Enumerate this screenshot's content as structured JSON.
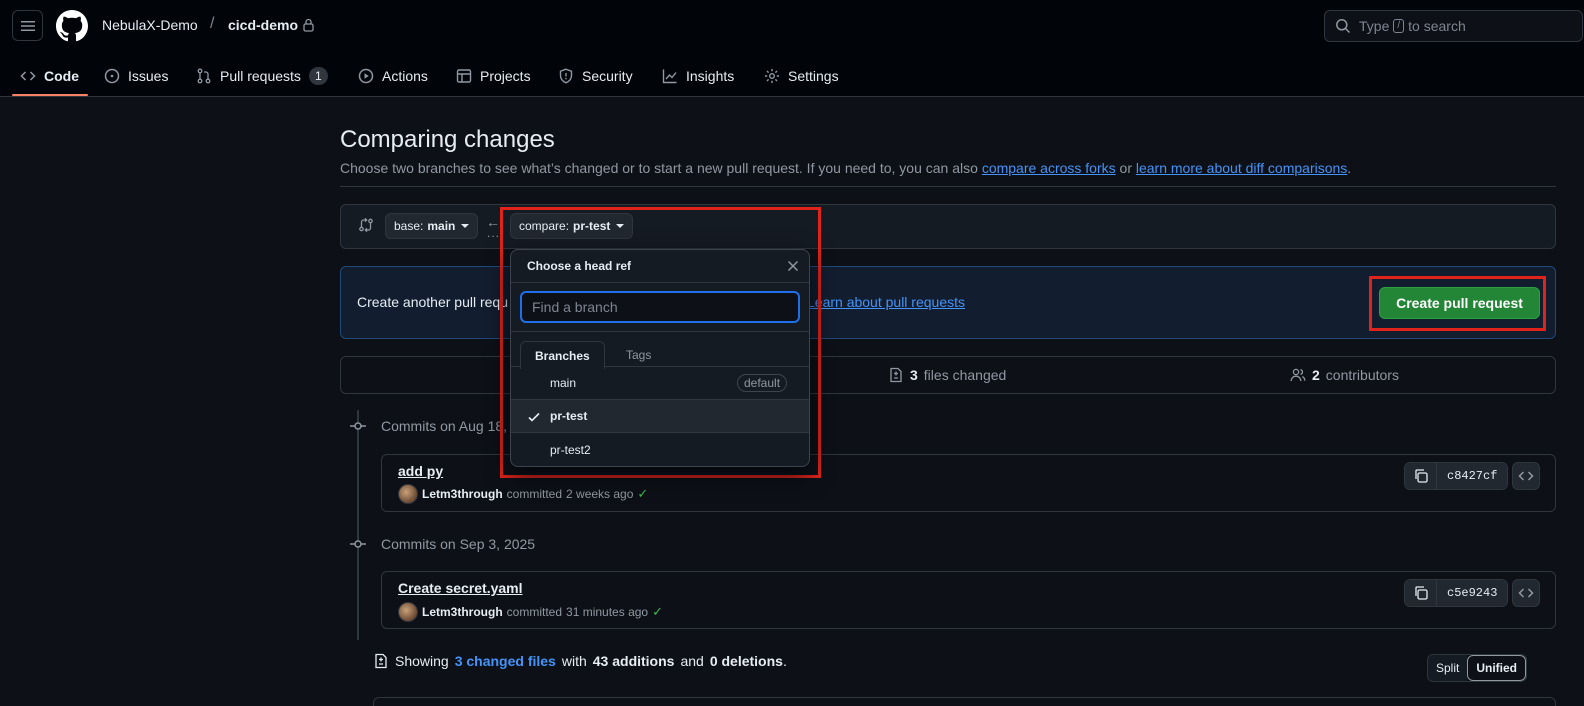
{
  "header": {
    "owner": "NebulaX-Demo",
    "separator": "/",
    "repo": "cicd-demo",
    "search_prefix": "Type",
    "search_key": "/",
    "search_suffix": "to search"
  },
  "nav": {
    "code": "Code",
    "issues": "Issues",
    "pull_requests": "Pull requests",
    "pull_requests_count": "1",
    "actions": "Actions",
    "projects": "Projects",
    "security": "Security",
    "insights": "Insights",
    "settings": "Settings"
  },
  "page": {
    "title": "Comparing changes",
    "desc_before": "Choose two branches to see what’s changed or to start a new pull request. If you need to, you can also ",
    "desc_link1": "compare across forks",
    "desc_middle": " or ",
    "desc_link2": "learn more about diff comparisons",
    "desc_after": "."
  },
  "range": {
    "base_prefix": "base:",
    "base_value": "main",
    "compare_prefix": "compare:",
    "compare_value": "pr-test",
    "arrow": "←",
    "dots": "..."
  },
  "flash": {
    "text": "Create another pull requ",
    "link": "Learn about pull requests",
    "button": "Create pull request"
  },
  "stats": {
    "files_count": "3",
    "files_label": "files changed",
    "contributors_count": "2",
    "contributors_label": "contributors"
  },
  "commit_groups": [
    {
      "heading": "Commits on Aug 18,",
      "title": "add py",
      "author": "Letm3through",
      "action": "committed",
      "time": "2 weeks ago",
      "sha": "c8427cf"
    },
    {
      "heading": "Commits on Sep 3, 2025",
      "title": "Create secret.yaml",
      "author": "Letm3through",
      "action": "committed",
      "time": "31 minutes ago",
      "sha": "c5e9243"
    }
  ],
  "summary": {
    "showing": "Showing",
    "changed_files": "3 changed files",
    "with": "with",
    "additions": "43 additions",
    "and": "and",
    "deletions": "0 deletions",
    "period": "."
  },
  "view_toggle": {
    "split": "Split",
    "unified": "Unified"
  },
  "dropdown": {
    "title": "Choose a head ref",
    "placeholder": "Find a branch",
    "tab_branches": "Branches",
    "tab_tags": "Tags",
    "items": [
      {
        "label": "main",
        "badge": "default"
      },
      {
        "label": "pr-test"
      },
      {
        "label": "pr-test2"
      }
    ]
  },
  "colors": {
    "accent": "#f78166",
    "link": "#4493f8",
    "primary_button": "#238636",
    "highlight_box": "#e0241b"
  }
}
